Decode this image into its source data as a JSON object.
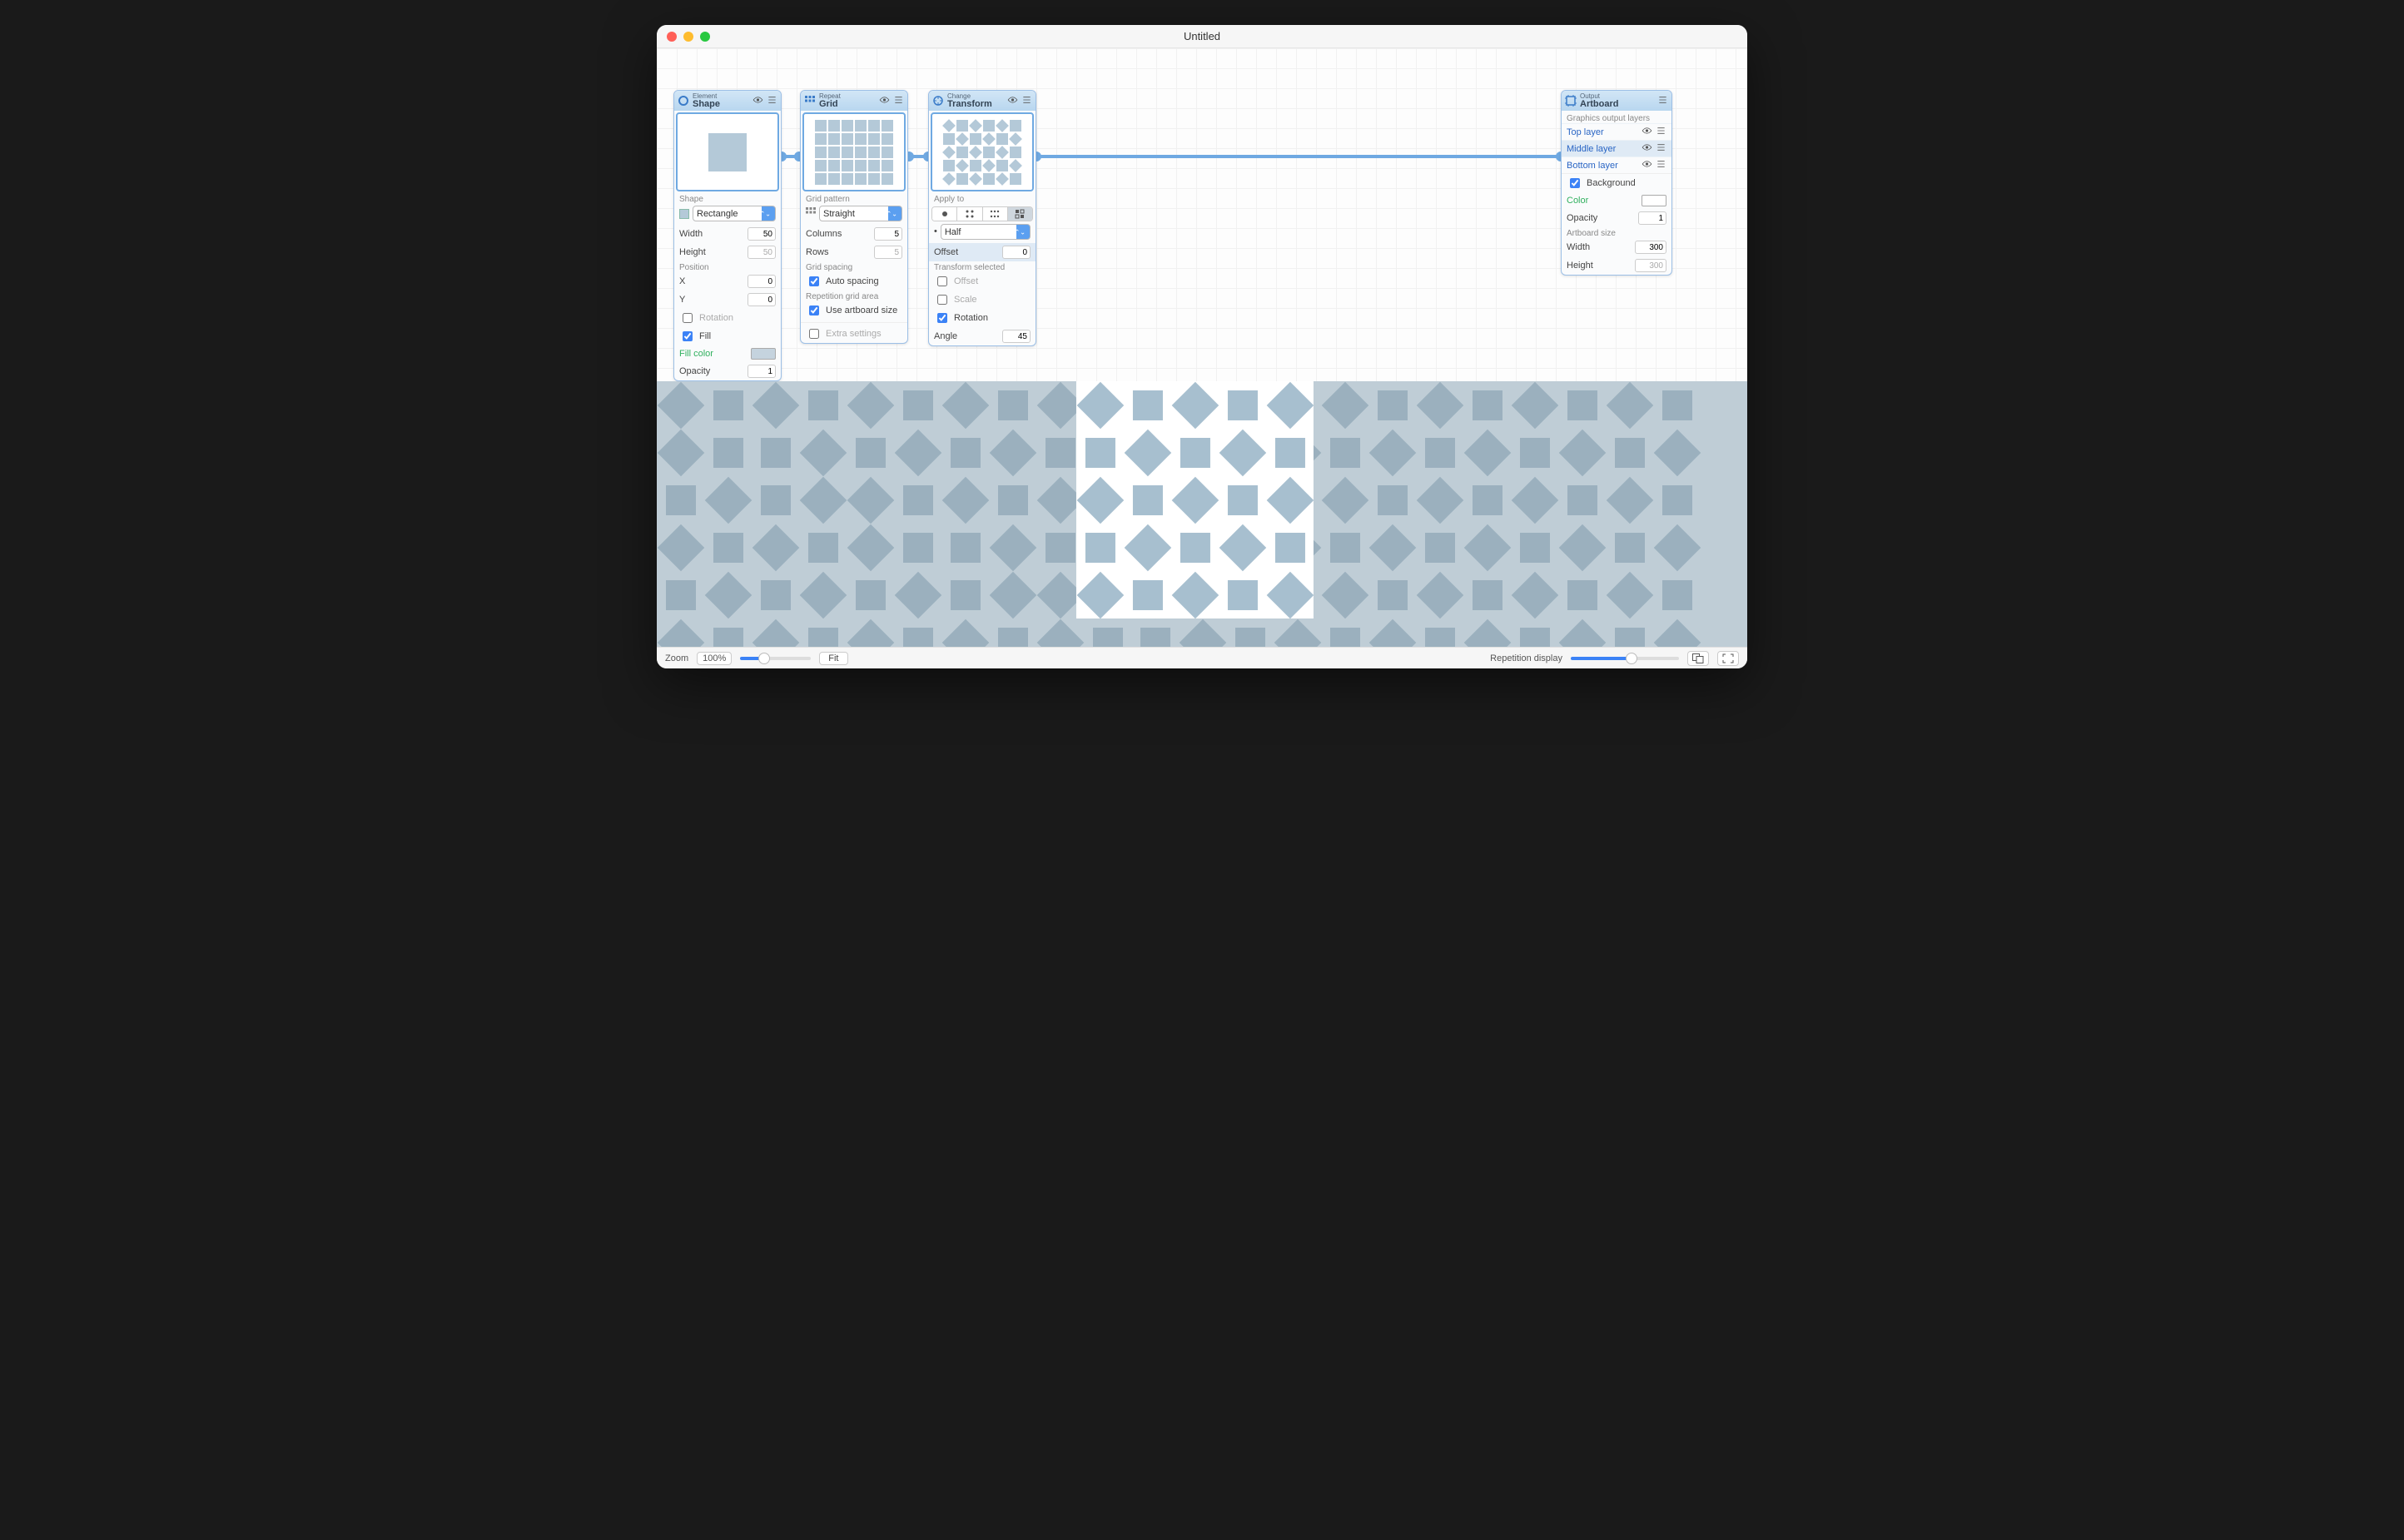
{
  "window": {
    "title": "Untitled"
  },
  "statusbar": {
    "zoom_label": "Zoom",
    "zoom_value": "100%",
    "fit_label": "Fit",
    "rep_display": "Repetition display"
  },
  "node_shape": {
    "subtitle": "Element",
    "title": "Shape",
    "section_shape": "Shape",
    "shape_value": "Rectangle",
    "width_label": "Width",
    "width_value": "50",
    "height_label": "Height",
    "height_value": "50",
    "section_position": "Position",
    "x_label": "X",
    "x_value": "0",
    "y_label": "Y",
    "y_value": "0",
    "rotation_label": "Rotation",
    "fill_label": "Fill",
    "fillcolor_label": "Fill color",
    "opacity_label": "Opacity",
    "opacity_value": "1"
  },
  "node_grid": {
    "subtitle": "Repeat",
    "title": "Grid",
    "section_pattern": "Grid pattern",
    "pattern_value": "Straight",
    "columns_label": "Columns",
    "columns_value": "5",
    "rows_label": "Rows",
    "rows_value": "5",
    "section_spacing": "Grid spacing",
    "auto_spacing_label": "Auto spacing",
    "section_area": "Repetition grid area",
    "use_artboard_label": "Use artboard size",
    "extra_label": "Extra settings"
  },
  "node_transform": {
    "subtitle": "Change",
    "title": "Transform",
    "section_apply": "Apply to",
    "apply_value": "Half",
    "offset_label": "Offset",
    "offset_value": "0",
    "section_tsel": "Transform selected",
    "offset_ck": "Offset",
    "scale_ck": "Scale",
    "rotation_ck": "Rotation",
    "angle_label": "Angle",
    "angle_value": "45"
  },
  "node_artboard": {
    "subtitle": "Output",
    "title": "Artboard",
    "section_layers": "Graphics output layers",
    "layer_top": "Top layer",
    "layer_mid": "Middle layer",
    "layer_bot": "Bottom layer",
    "background_label": "Background",
    "color_label": "Color",
    "opacity_label": "Opacity",
    "opacity_value": "1",
    "section_size": "Artboard size",
    "width_label": "Width",
    "width_value": "300",
    "height_label": "Height",
    "height_value": "300"
  }
}
